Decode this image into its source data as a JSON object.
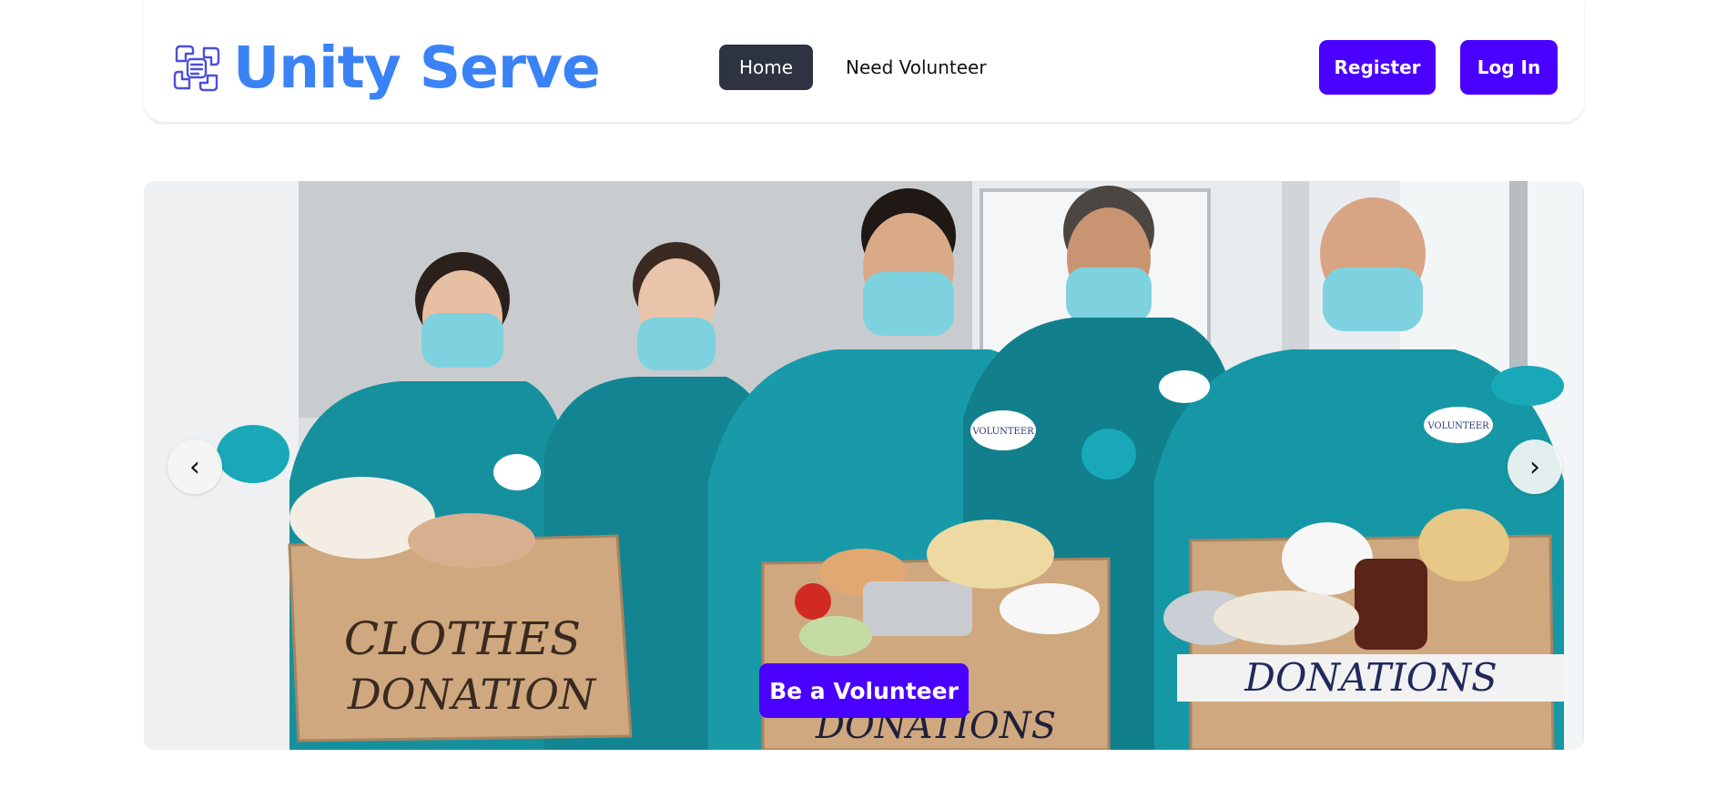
{
  "brand": {
    "name": "Unity Serve",
    "logo_icon": "hands-together-icon",
    "color": "#3b82f6"
  },
  "nav": {
    "items": [
      {
        "label": "Home",
        "active": true
      },
      {
        "label": "Need Volunteer",
        "active": false
      }
    ]
  },
  "auth": {
    "register_label": "Register",
    "login_label": "Log In"
  },
  "hero": {
    "image_subject": "volunteers-with-donation-boxes",
    "prev_glyph": "‹",
    "next_glyph": "›",
    "cta_label": "Be a Volunteer",
    "box_labels": {
      "left_line1": "CLOTHES",
      "left_line2": "DONATION",
      "middle": "DONATIONS",
      "right": "DONATIONS"
    },
    "badge_text": "VOLUNTEER"
  },
  "colors": {
    "accent": "#4a00ff",
    "nav_active_bg": "#2d3340",
    "shirt": "#17909e"
  }
}
